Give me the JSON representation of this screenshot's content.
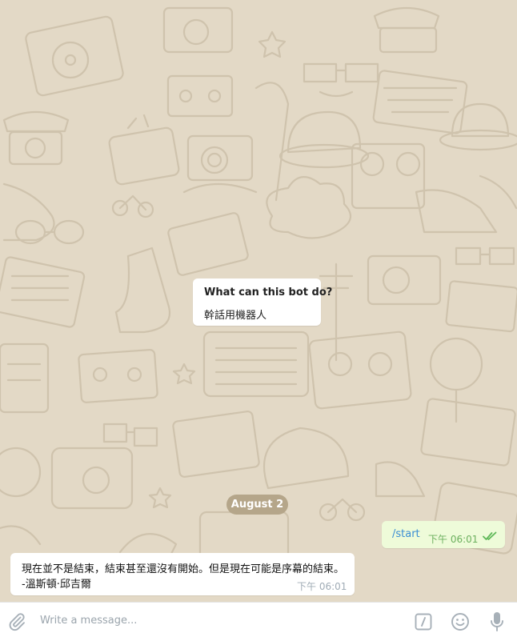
{
  "bot_info": {
    "title": "What can this bot do?",
    "description": "幹話用機器人"
  },
  "date_separator": "August 2",
  "outgoing_message": {
    "text": "/start",
    "time": "下午 06:01",
    "status_icon": "double-check-icon"
  },
  "incoming_message": {
    "line1": "現在並不是結束，結束甚至還沒有開始。但是現在可能是序幕的結束。",
    "line2": " -溫斯頓·邱吉爾",
    "time": "下午 06:01"
  },
  "composer": {
    "placeholder": "Write a message...",
    "icons": [
      "paperclip-icon",
      "bot-commands-icon",
      "emoji-icon",
      "microphone-icon"
    ]
  },
  "colors": {
    "chat_background": "#e3d9c6",
    "date_pill": "#b5a68a",
    "outgoing_bubble": "#eefbd9",
    "link_text": "#3a8ed4",
    "outgoing_time": "#6cb05e",
    "incoming_time": "#a0acb6",
    "icon_gray": "#a7b0b8"
  }
}
